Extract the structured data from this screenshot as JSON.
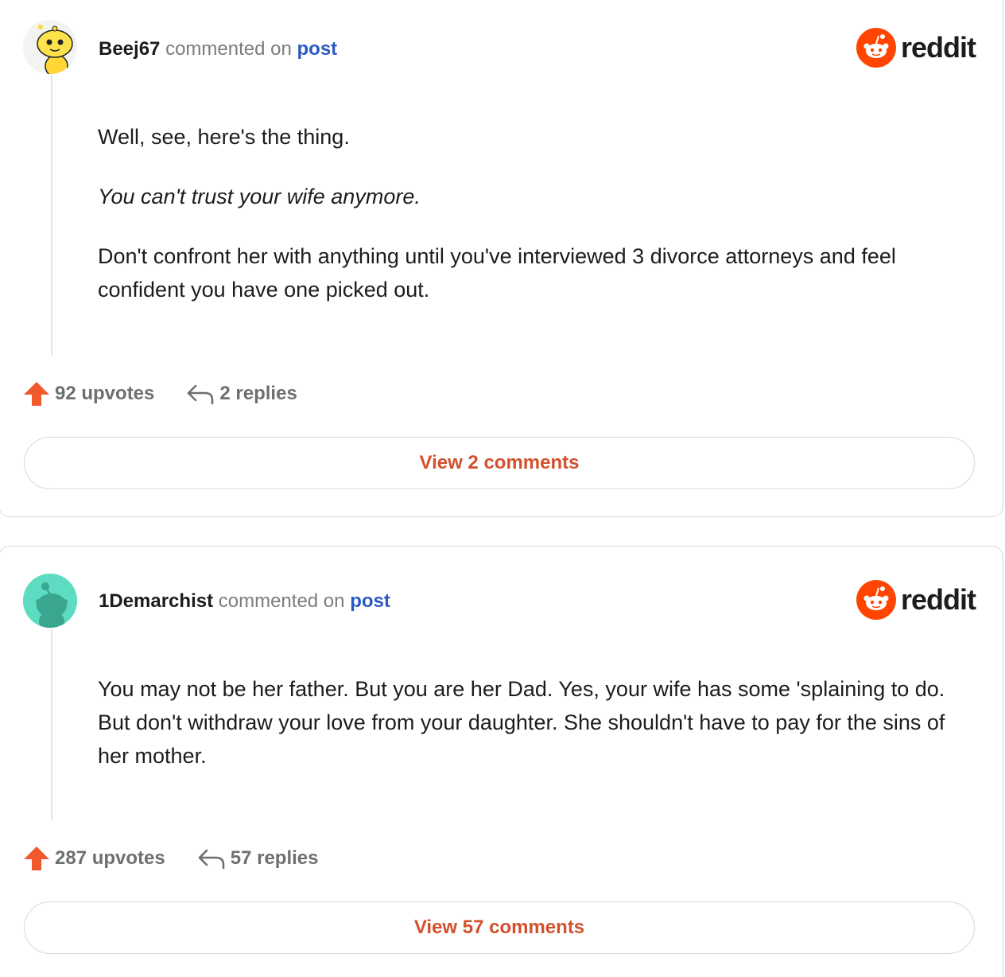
{
  "comments": [
    {
      "username": "Beej67",
      "action": "commented on",
      "post_link": "post",
      "brand": "reddit",
      "paragraphs": [
        "Well, see, here's the thing.",
        "You can't trust your wife anymore.",
        "Don't confront her with anything until you've interviewed 3 divorce attorneys and feel confident you have one picked out."
      ],
      "upvotes": "92 upvotes",
      "replies": "2 replies",
      "view_button": "View 2 comments"
    },
    {
      "username": "1Demarchist",
      "action": "commented on",
      "post_link": "post",
      "brand": "reddit",
      "paragraphs": [
        "You may not be her father. But you are her Dad. Yes, your wife has some 'splaining to do. But don't withdraw your love from your daughter. She shouldn't have to pay for the sins of her mother."
      ],
      "upvotes": "287 upvotes",
      "replies": "57 replies",
      "view_button": "View 57 comments"
    }
  ],
  "colors": {
    "upvote": "#f0592b",
    "link": "#2b59c3",
    "button_text": "#d2502c",
    "reddit_orange": "#ff4500"
  },
  "icons": {
    "upvote": "arrow-up-icon",
    "reply": "reply-arrow-icon",
    "brand": "reddit-snoo-icon"
  }
}
